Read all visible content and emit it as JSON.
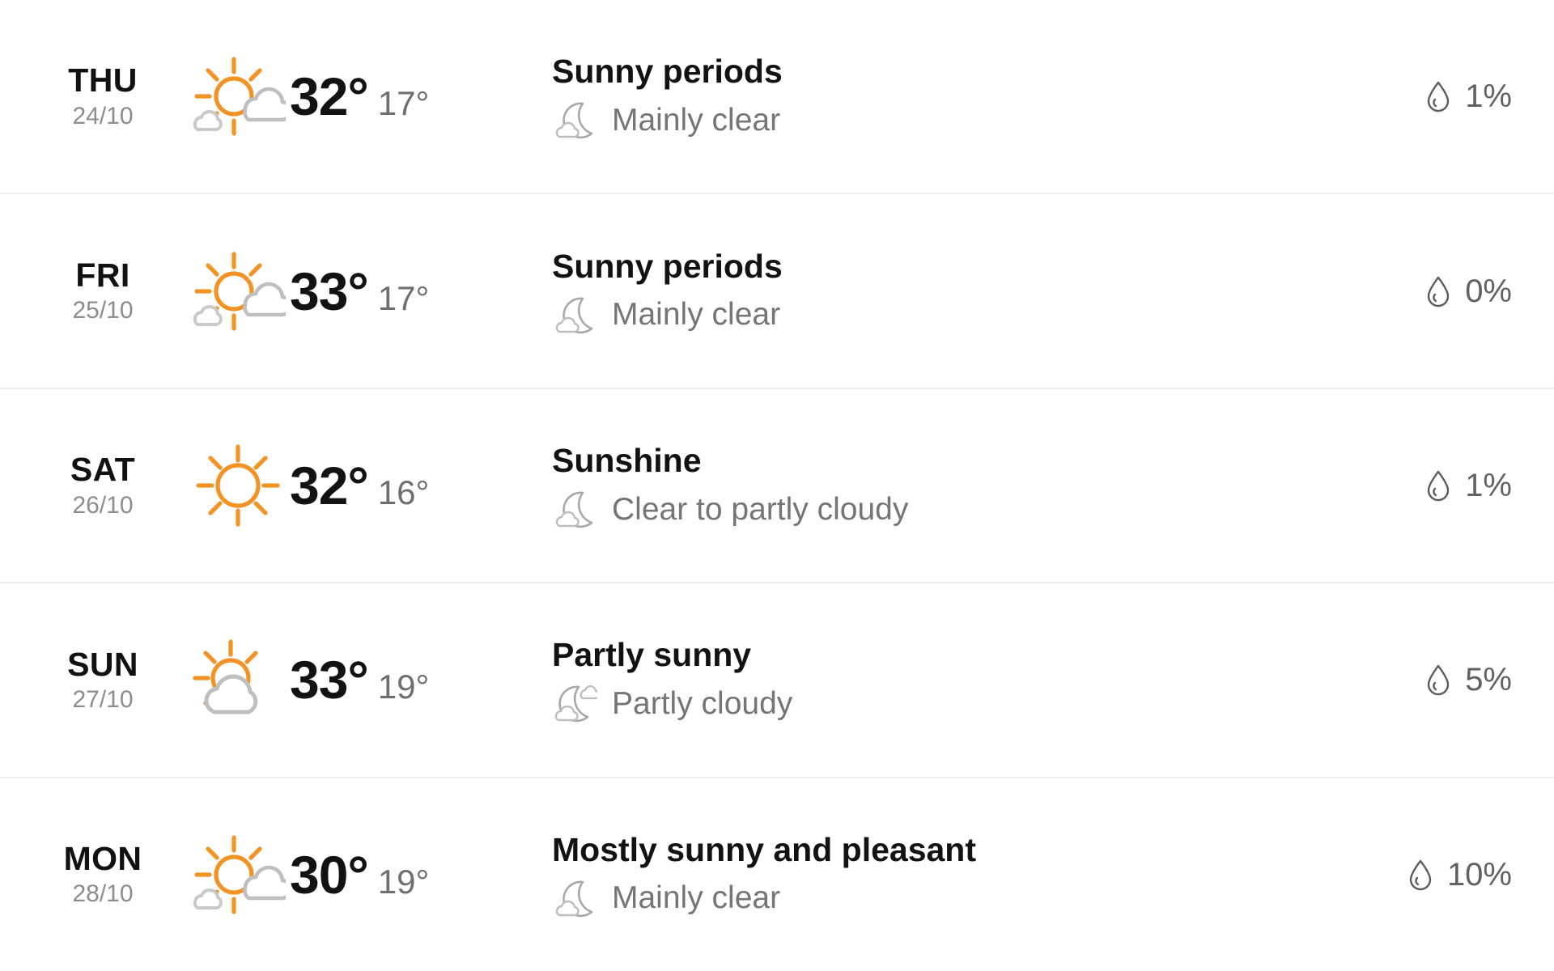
{
  "forecast": {
    "rows": [
      {
        "day": "THU",
        "date": "24/10",
        "day_icon": "sun-behind-small-cloud-icon",
        "temp_high": "32°",
        "temp_low": "17°",
        "desc_day": "Sunny periods",
        "night_icon": "crescent-moon-with-cloud-icon",
        "desc_night": "Mainly clear",
        "precip_icon": "water-droplet-icon",
        "precip": "1%"
      },
      {
        "day": "FRI",
        "date": "25/10",
        "day_icon": "sun-behind-small-cloud-icon",
        "temp_high": "33°",
        "temp_low": "17°",
        "desc_day": "Sunny periods",
        "night_icon": "crescent-moon-with-cloud-icon",
        "desc_night": "Mainly clear",
        "precip_icon": "water-droplet-icon",
        "precip": "0%"
      },
      {
        "day": "SAT",
        "date": "26/10",
        "day_icon": "sun-icon",
        "temp_high": "32°",
        "temp_low": "16°",
        "desc_day": "Sunshine",
        "night_icon": "crescent-moon-with-cloud-icon",
        "desc_night": "Clear to partly cloudy",
        "precip_icon": "water-droplet-icon",
        "precip": "1%"
      },
      {
        "day": "SUN",
        "date": "27/10",
        "day_icon": "sun-behind-large-cloud-icon",
        "temp_high": "33°",
        "temp_low": "19°",
        "desc_day": "Partly sunny",
        "night_icon": "crescent-moon-with-two-clouds-icon",
        "desc_night": "Partly cloudy",
        "precip_icon": "water-droplet-icon",
        "precip": "5%"
      },
      {
        "day": "MON",
        "date": "28/10",
        "day_icon": "sun-behind-small-cloud-icon",
        "temp_high": "30°",
        "temp_low": "19°",
        "desc_day": "Mostly sunny and pleasant",
        "night_icon": "crescent-moon-with-cloud-icon",
        "desc_night": "Mainly clear",
        "precip_icon": "water-droplet-icon",
        "precip": "10%"
      }
    ]
  },
  "colors": {
    "sun_orange": "#F39325",
    "cloud_gray": "#BFBFBF",
    "moon_gray": "#A8A8A8",
    "text_primary": "#121212",
    "text_secondary": "#757575",
    "divider": "#EEEEEE",
    "background": "#FFFFFF"
  }
}
